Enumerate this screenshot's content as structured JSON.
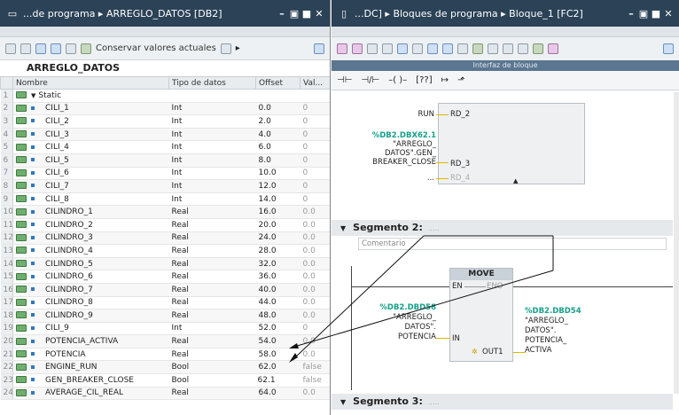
{
  "left": {
    "title": "...de programa ▸ ARREGLO_DATOS [DB2]",
    "keep_values_label": "Conservar valores actuales",
    "db_name": "ARREGLO_DATOS",
    "columns": [
      "Nombre",
      "Tipo de datos",
      "Offset",
      "Val..."
    ],
    "rows": [
      {
        "n": "1",
        "name": "Static",
        "type": "",
        "offset": "",
        "val": ""
      },
      {
        "n": "2",
        "name": "CILI_1",
        "type": "Int",
        "offset": "0.0",
        "val": "0"
      },
      {
        "n": "3",
        "name": "CILI_2",
        "type": "Int",
        "offset": "2.0",
        "val": "0"
      },
      {
        "n": "4",
        "name": "CILI_3",
        "type": "Int",
        "offset": "4.0",
        "val": "0"
      },
      {
        "n": "5",
        "name": "CILI_4",
        "type": "Int",
        "offset": "6.0",
        "val": "0"
      },
      {
        "n": "6",
        "name": "CILI_5",
        "type": "Int",
        "offset": "8.0",
        "val": "0"
      },
      {
        "n": "7",
        "name": "CILI_6",
        "type": "Int",
        "offset": "10.0",
        "val": "0"
      },
      {
        "n": "8",
        "name": "CILI_7",
        "type": "Int",
        "offset": "12.0",
        "val": "0"
      },
      {
        "n": "9",
        "name": "CILI_8",
        "type": "Int",
        "offset": "14.0",
        "val": "0"
      },
      {
        "n": "10",
        "name": "CILINDRO_1",
        "type": "Real",
        "offset": "16.0",
        "val": "0.0"
      },
      {
        "n": "11",
        "name": "CILINDRO_2",
        "type": "Real",
        "offset": "20.0",
        "val": "0.0"
      },
      {
        "n": "12",
        "name": "CILINDRO_3",
        "type": "Real",
        "offset": "24.0",
        "val": "0.0"
      },
      {
        "n": "13",
        "name": "CILINDRO_4",
        "type": "Real",
        "offset": "28.0",
        "val": "0.0"
      },
      {
        "n": "14",
        "name": "CILINDRO_5",
        "type": "Real",
        "offset": "32.0",
        "val": "0.0"
      },
      {
        "n": "15",
        "name": "CILINDRO_6",
        "type": "Real",
        "offset": "36.0",
        "val": "0.0"
      },
      {
        "n": "16",
        "name": "CILINDRO_7",
        "type": "Real",
        "offset": "40.0",
        "val": "0.0"
      },
      {
        "n": "17",
        "name": "CILINDRO_8",
        "type": "Real",
        "offset": "44.0",
        "val": "0.0"
      },
      {
        "n": "18",
        "name": "CILINDRO_9",
        "type": "Real",
        "offset": "48.0",
        "val": "0.0"
      },
      {
        "n": "19",
        "name": "CILI_9",
        "type": "Int",
        "offset": "52.0",
        "val": "0"
      },
      {
        "n": "20",
        "name": "POTENCIA_ACTIVA",
        "type": "Real",
        "offset": "54.0",
        "val": "0.0"
      },
      {
        "n": "21",
        "name": "POTENCIA",
        "type": "Real",
        "offset": "58.0",
        "val": "0.0"
      },
      {
        "n": "22",
        "name": "ENGINE_RUN",
        "type": "Bool",
        "offset": "62.0",
        "val": "false"
      },
      {
        "n": "23",
        "name": "GEN_BREAKER_CLOSE",
        "type": "Bool",
        "offset": "62.1",
        "val": "false"
      },
      {
        "n": "24",
        "name": "AVERAGE_CIL_REAL",
        "type": "Real",
        "offset": "64.0",
        "val": "0.0"
      }
    ]
  },
  "right": {
    "title": "...DC] ▸ Bloques de programa ▸ Bloque_1 [FC2]",
    "interface_label": "Interfaz de bloque",
    "seg1": {
      "run_in": "RUN",
      "rd2": "RD_2",
      "tag_addr": "%DB2.DBX62.1",
      "tag_text": [
        "\"ARREGLO_",
        "DATOS\".GEN_",
        "BREAKER_CLOSE"
      ],
      "rd3": "RD_3",
      "rd4": "RD_4",
      "dots": "..."
    },
    "seg2": {
      "title": "Segmento 2:",
      "dots": ".....",
      "comment": "Comentario",
      "block": "MOVE",
      "en": "EN",
      "eno": "ENO",
      "in": "IN",
      "out1": "OUT1",
      "in_addr": "%DB2.DBD58",
      "in_text": [
        "\"ARREGLO_",
        "DATOS\".",
        "POTENCIA"
      ],
      "out_addr": "%DB2.DBD54",
      "out_text": [
        "\"ARREGLO_",
        "DATOS\".",
        "POTENCIA_",
        "ACTIVA"
      ]
    },
    "seg3": {
      "title": "Segmento 3:",
      "dots": "....."
    }
  }
}
